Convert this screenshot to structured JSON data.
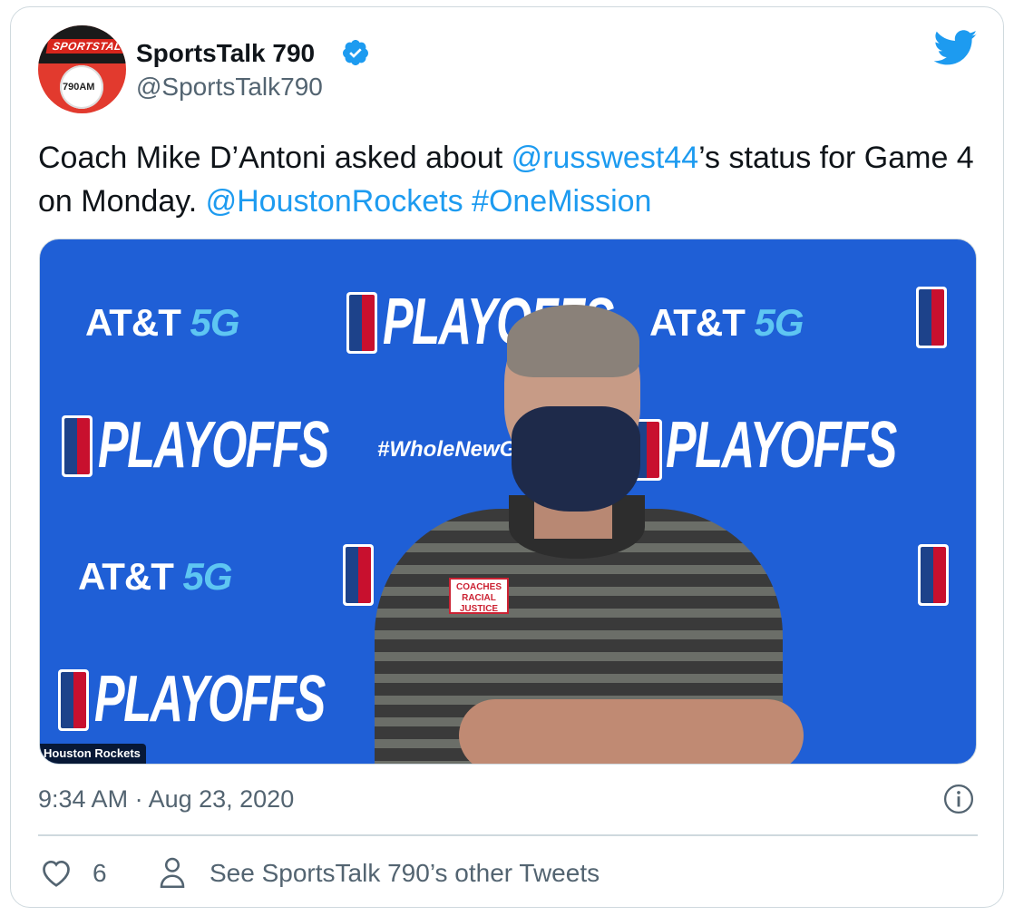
{
  "account": {
    "name": "SportsTalk 790",
    "handle": "@SportsTalk790",
    "avatar_brand": "SPORTSTALK",
    "avatar_freq": "790AM"
  },
  "tweet": {
    "text_part1": "Coach Mike D’Antoni asked about ",
    "mention1": "@russwest44",
    "text_part2": "’s status for Game 4 on Monday. ",
    "mention2": "@HoustonRockets",
    "space": " ",
    "hashtag": "#OneMission"
  },
  "media": {
    "overlay_label": "Houston Rockets",
    "backdrop": {
      "att": "AT&T",
      "g5": "5G",
      "playoffs": "PLAYOFFS",
      "hashtag": "#WholeNewGa"
    },
    "pin_text": "COACHES RACIAL JUSTICE"
  },
  "meta": {
    "timestamp": "9:34 AM · Aug 23, 2020"
  },
  "actions": {
    "likes": "6",
    "see_more": "See SportsTalk 790’s other Tweets"
  },
  "colors": {
    "link": "#1d9bf0",
    "muted": "#536471",
    "border": "#cfd9de",
    "media_bg": "#1f5fd6"
  }
}
